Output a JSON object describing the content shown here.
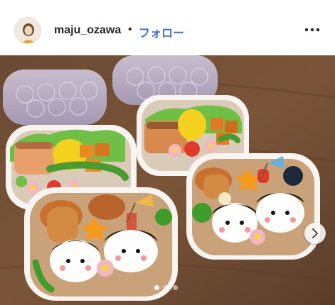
{
  "post": {
    "username": "maju_ozawa",
    "separator": "•",
    "follow_label": "フォロー"
  },
  "icons": {
    "avatar": "profile-avatar",
    "more": "more-options-icon",
    "next": "chevron-right-icon"
  },
  "carousel": {
    "total": 3,
    "active_index": 0
  },
  "colors": {
    "follow": "#3f6fd8",
    "username": "#262626"
  }
}
